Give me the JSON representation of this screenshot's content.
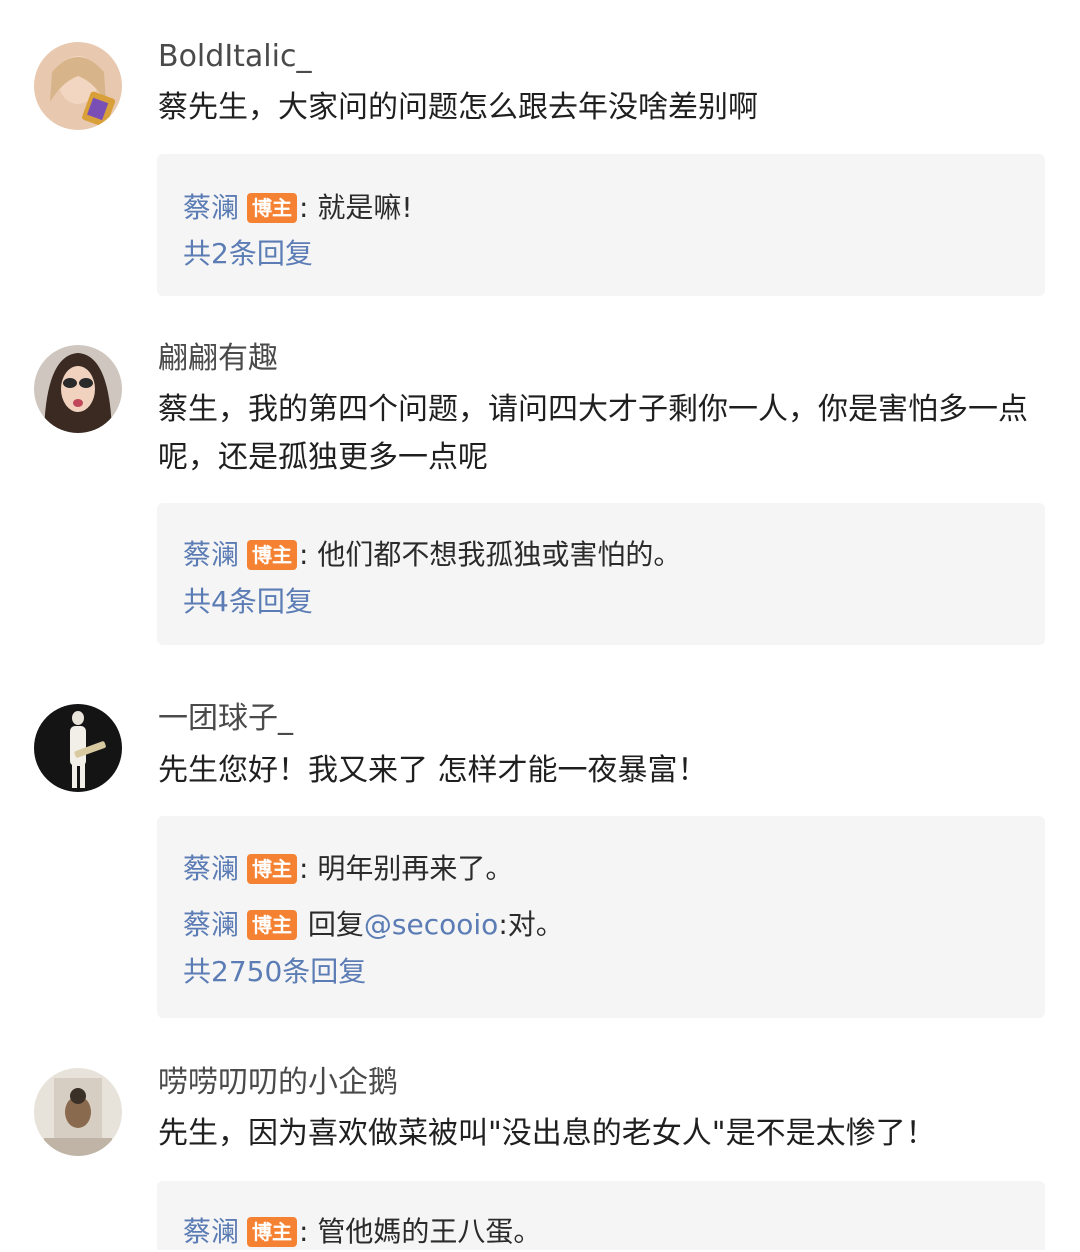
{
  "comments": [
    {
      "username": "BoldItalic_",
      "text": "蔡先生，大家问的问题怎么跟去年没啥差别啊",
      "replies": [
        {
          "author": "蔡澜",
          "badge": "博主",
          "sep": ":",
          "text": " 就是嘛!"
        }
      ],
      "reply_count": "共2条回复"
    },
    {
      "username": "翩翩有趣",
      "text": "蔡生，我的第四个问题，请问四大才子剩你一人，你是害怕多一点呢，还是孤独更多一点呢",
      "replies": [
        {
          "author": "蔡澜",
          "badge": "博主",
          "sep": ":",
          "text": " 他们都不想我孤独或害怕的。"
        }
      ],
      "reply_count": "共4条回复"
    },
    {
      "username": "一团球子_",
      "text": "先生您好！我又来了 怎样才能一夜暴富！",
      "replies": [
        {
          "author": "蔡澜",
          "badge": "博主",
          "sep": ":",
          "text": " 明年别再来了。"
        },
        {
          "author": "蔡澜",
          "badge": "博主",
          "prefix": " 回复",
          "mention": "@secooio",
          "text": ":对。"
        }
      ],
      "reply_count": "共2750条回复"
    },
    {
      "username": "唠唠叨叨的小企鹅",
      "text": "先生，因为喜欢做菜被叫\"没出息的老女人\"是不是太惨了！",
      "replies": [
        {
          "author": "蔡澜",
          "badge": "博主",
          "sep": ":",
          "text": " 管他媽的王八蛋。"
        }
      ]
    }
  ],
  "colors": {
    "link_blue": "#5b7cb4",
    "badge_orange": "#f58232",
    "reply_bg": "#f5f5f5"
  }
}
